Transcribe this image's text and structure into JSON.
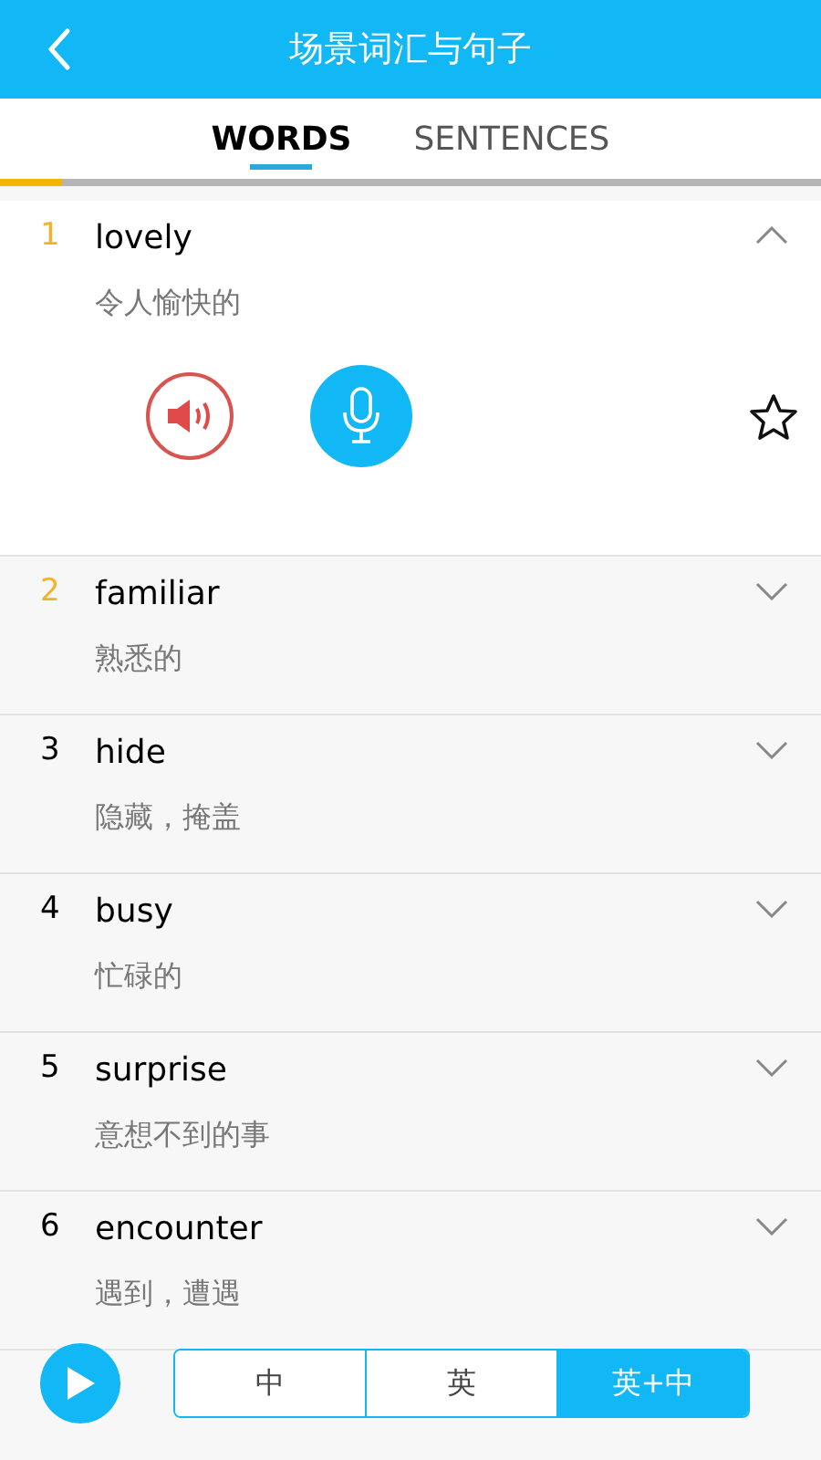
{
  "header": {
    "title": "场景词汇与句子"
  },
  "tabs": [
    {
      "label": "WORDS",
      "selected": true
    },
    {
      "label": "SENTENCES",
      "selected": false
    }
  ],
  "progress": {
    "level": 0.075
  },
  "words": [
    {
      "number": "1",
      "word": "lovely",
      "meaning": "令人愉快的",
      "highlighted": true,
      "expanded": true,
      "starred": false
    },
    {
      "number": "2",
      "word": "familiar",
      "meaning": "熟悉的",
      "highlighted": true,
      "expanded": false
    },
    {
      "number": "3",
      "word": "hide",
      "meaning": "隐藏，掩盖",
      "highlighted": false,
      "expanded": false
    },
    {
      "number": "4",
      "word": "busy",
      "meaning": "忙碌的",
      "highlighted": false,
      "expanded": false
    },
    {
      "number": "5",
      "word": "surprise",
      "meaning": "意想不到的事",
      "highlighted": false,
      "expanded": false
    },
    {
      "number": "6",
      "word": "encounter",
      "meaning": "遇到，遭遇",
      "highlighted": false,
      "expanded": false
    }
  ],
  "modes": [
    {
      "label": "中",
      "selected": false
    },
    {
      "label": "英",
      "selected": false
    },
    {
      "label": "英+中",
      "selected": true
    }
  ]
}
